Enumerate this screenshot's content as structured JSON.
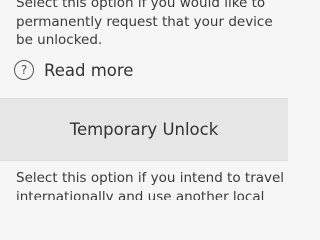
{
  "permanent": {
    "description_lines": [
      "Select this option if you would like to",
      "permanently request that your device",
      "be unlocked."
    ],
    "read_more_label": "Read more",
    "help_icon": "question-circle-icon",
    "help_glyph": "?"
  },
  "temporary": {
    "button_label": "Temporary Unlock",
    "description_lines": [
      "Select this option if you intend to travel",
      "internationally and use another local"
    ]
  }
}
